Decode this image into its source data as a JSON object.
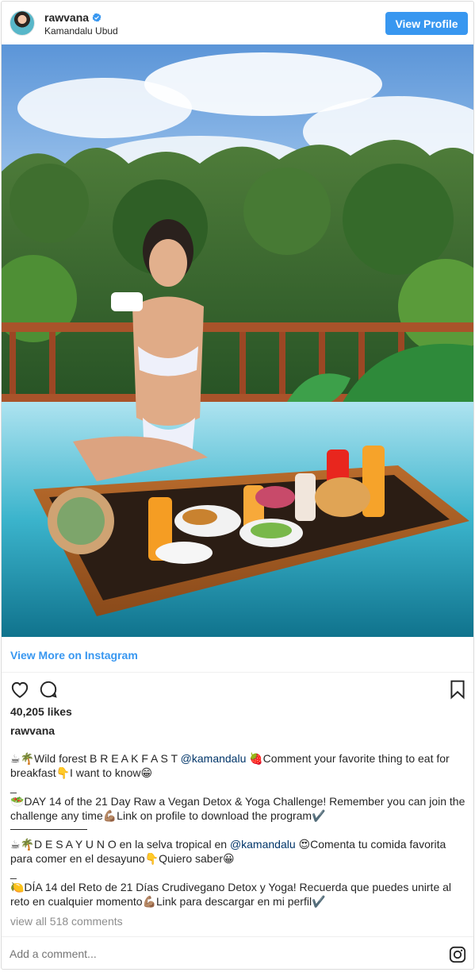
{
  "header": {
    "username": "rawvana",
    "location": "Kamandalu Ubud",
    "view_profile_label": "View Profile",
    "verified_icon": "verified-badge-icon"
  },
  "post": {
    "view_more_label": "View More on Instagram",
    "likes_text": "40,205 likes",
    "caption_username": "rawvana",
    "view_all_comments": "view all 518 comments",
    "comment_placeholder": "Add a comment..."
  },
  "caption": {
    "en_line1_pre": "☕🌴Wild forest B R E A K F A S T ",
    "en_mention": "@kamandalu",
    "en_line1_post": " 🍓Comment your favorite thing to eat for breakfast👇I want to know😁",
    "dash1": "_",
    "en_line2": "🥗DAY 14 of the 21 Day Raw a Vegan Detox & Yoga Challenge! Remember you can join the challenge any time💪🏽Link on profile to download the program✔️",
    "es_line1_pre": "☕🌴D E S A Y U N O en la selva tropical en ",
    "es_mention": "@kamandalu",
    "es_line1_post": " 😍Comenta tu comida favorita para comer en el desayuno👇Quiero saber😀",
    "dash2": "_",
    "es_line2": "🍋DÍA 14 del Reto de 21 Días Crudivegano Detox y Yoga! Recuerda que puedes unirte al reto en cualquier momento💪🏽Link para descargar en mi perfil✔️"
  },
  "icons": {
    "like": "heart-icon",
    "comment": "comment-icon",
    "save": "bookmark-icon",
    "instagram": "instagram-glyph-icon"
  },
  "colors": {
    "accent": "#3897f0",
    "text": "#262626",
    "muted": "#8e8e8e",
    "mention": "#003569"
  }
}
